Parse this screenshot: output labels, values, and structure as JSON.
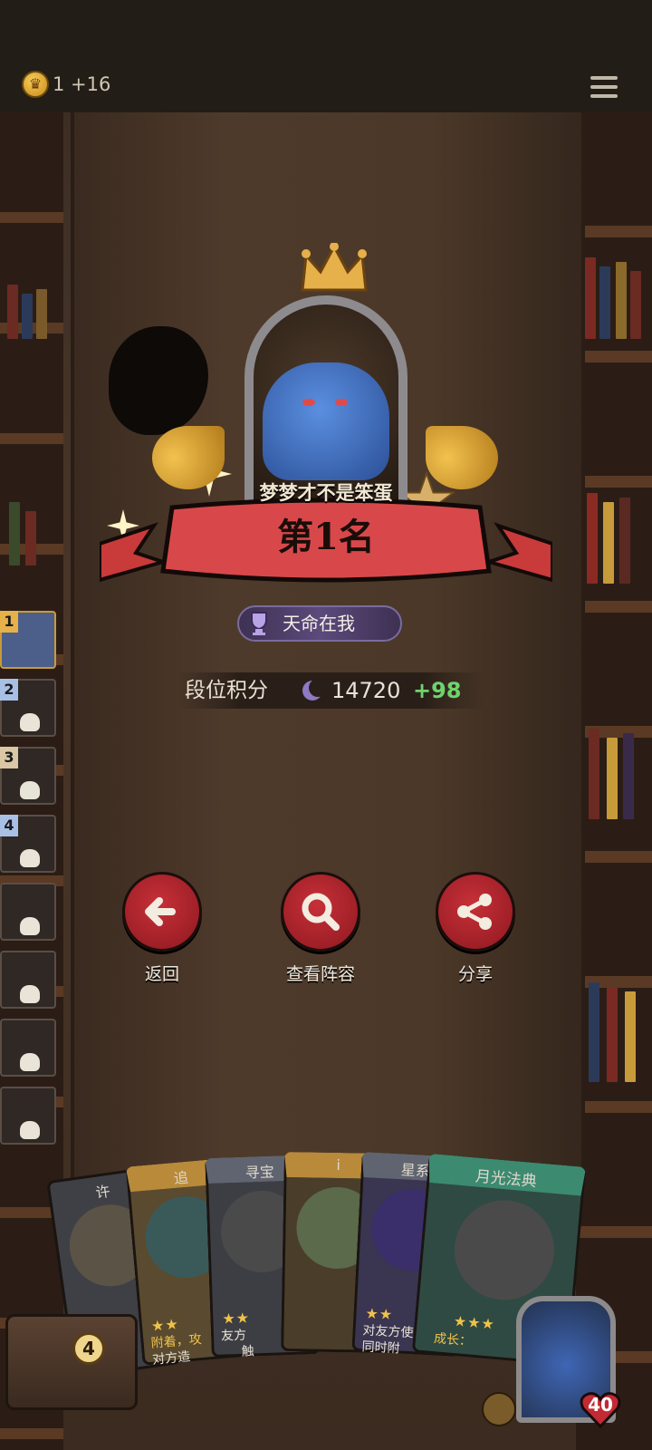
{
  "topbar": {
    "coin_icon": "crown-coin-icon",
    "coin_count": "1 +16",
    "menu_icon": "hamburger-menu-icon"
  },
  "result": {
    "player_name": "梦梦才不是笨蛋",
    "rank_prefix": "第",
    "rank_number": "1",
    "rank_suffix": "名",
    "achievement": "天命在我",
    "score_label": "段位积分",
    "score_value": "14720",
    "score_delta": "+98"
  },
  "sidebar": {
    "ranks": [
      "1",
      "2",
      "3",
      "4",
      "",
      "",
      "",
      ""
    ]
  },
  "actions": {
    "back": "返回",
    "view_lineup": "查看阵容",
    "share": "分享"
  },
  "cards": [
    {
      "title": "许",
      "stars": "",
      "desc": ""
    },
    {
      "title": "追",
      "stars": "★★",
      "desc_line1": "附着，攻",
      "desc_line2": "对方造"
    },
    {
      "title": "寻宝",
      "stars": "★★",
      "desc_line1": "友方",
      "desc_line2": "触"
    },
    {
      "title": "i",
      "stars": "",
      "desc": ""
    },
    {
      "title": "星系",
      "stars": "★★",
      "desc_line1": "对友方使",
      "desc_line2": "同时附"
    },
    {
      "title": "月光法典",
      "stars": "★★★",
      "desc_line1": "成长：",
      "desc_line2": ""
    }
  ],
  "bottom": {
    "chest_count": "4",
    "hero_hp": "40"
  },
  "colors": {
    "red_button": "#c73038",
    "gold": "#f0c24a",
    "delta_green": "#6fd36c"
  }
}
